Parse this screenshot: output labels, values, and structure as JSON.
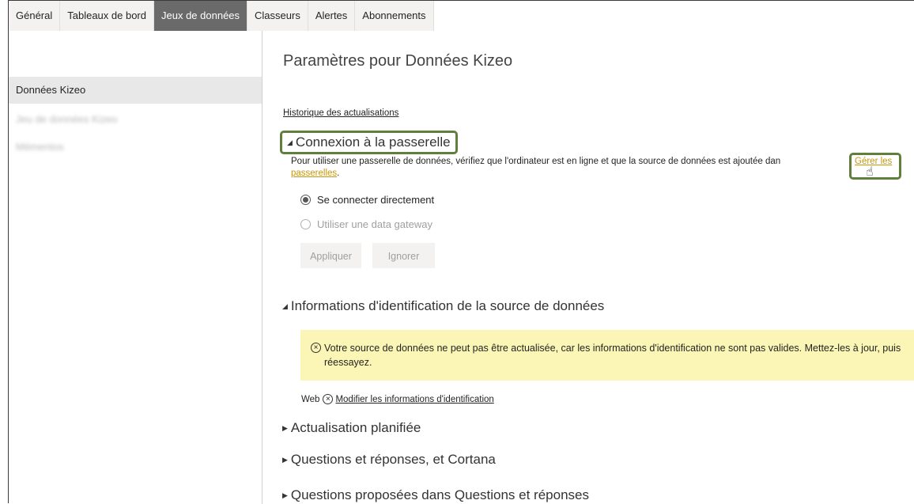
{
  "tabs": [
    "Général",
    "Tableaux de bord",
    "Jeux de données",
    "Classeurs",
    "Alertes",
    "Abonnements"
  ],
  "active_tab": "Jeux de données",
  "sidebar": {
    "selected": "Données Kizeo",
    "blurred_items": [
      "Jeu de données Kizeo",
      "Mémentos"
    ]
  },
  "main": {
    "title": "Paramètres pour Données Kizeo",
    "history_link": "Historique des actualisations",
    "gateway": {
      "header": "Connexion à la passerelle",
      "desc": "Pour utiliser une passerelle de données, vérifiez que l'ordinateur est en ligne et que la source de données est ajoutée dan",
      "link_part1": "Gérer les",
      "link_part2": "passerelles",
      "desc_end": ".",
      "option1": "Se connecter directement",
      "option2": "Utiliser une data gateway",
      "apply": "Appliquer",
      "ignore": "Ignorer"
    },
    "credentials": {
      "header": "Informations d'identification de la source de données",
      "warning": "Votre source de données ne peut pas être actualisée, car les informations d'identification ne sont pas valides. Mettez-les à jour, puis réessayez.",
      "web_label": "Web",
      "edit_link": "Modifier les informations d'identification"
    },
    "scheduled": "Actualisation planifiée",
    "qa": "Questions et réponses, et Cortana",
    "qa_suggested": "Questions proposées dans Questions et réponses"
  },
  "colors": {
    "highlight_border": "#5f7f3a",
    "link_gold": "#c8960a",
    "warning_bg": "#fbf6b5",
    "active_tab": "#6a6a6a"
  }
}
